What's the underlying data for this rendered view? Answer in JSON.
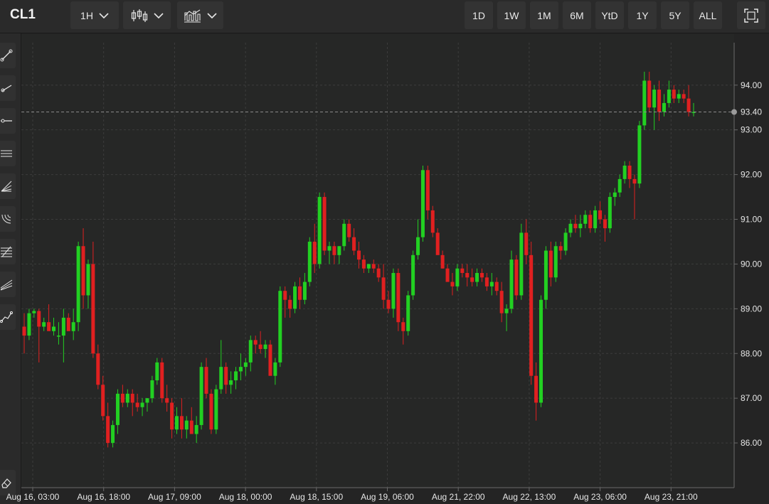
{
  "header": {
    "symbol": "CL1",
    "interval_label": "1H",
    "chart_type_icon": "candlestick-icon",
    "indicators_icon": "indicators-icon",
    "ranges": [
      "1D",
      "1W",
      "1M",
      "6M",
      "YtD",
      "1Y",
      "5Y",
      "ALL"
    ],
    "fullscreen_icon": "fullscreen-icon"
  },
  "sidebar": {
    "tools": [
      "trendline-icon",
      "ray-icon",
      "horizontal-line-icon",
      "parallel-channel-icon",
      "fan-icon",
      "arc-icon",
      "fibonacci-retracement-icon",
      "fibonacci-fan-icon",
      "polyline-icon"
    ],
    "bottom_tool": "eraser-icon"
  },
  "colors": {
    "up": "#22d022",
    "down": "#e02020",
    "background": "#262726",
    "grid": "#3c3c3c",
    "text": "#e6e6e6"
  },
  "chart_data": {
    "type": "candlestick",
    "title": "",
    "ylim": [
      85.0,
      94.95
    ],
    "y_ticks": [
      "86.00",
      "87.00",
      "88.00",
      "89.00",
      "90.00",
      "91.00",
      "92.00",
      "93.00",
      "94.00"
    ],
    "last_price": "93.40",
    "x_ticks": [
      "Aug 16, 03:00",
      "Aug 16, 18:00",
      "Aug 17, 09:00",
      "Aug 18, 00:00",
      "Aug 18, 15:00",
      "Aug 19, 06:00",
      "Aug 21, 22:00",
      "Aug 22, 13:00",
      "Aug 23, 06:00",
      "Aug 23, 21:00"
    ],
    "grid": true,
    "candles": [
      [
        88.6,
        88.9,
        88.0,
        88.4
      ],
      [
        88.4,
        89.0,
        88.3,
        88.9
      ],
      [
        88.9,
        89.0,
        88.8,
        88.95
      ],
      [
        88.95,
        89.0,
        87.8,
        88.6
      ],
      [
        88.6,
        88.8,
        88.5,
        88.7
      ],
      [
        88.7,
        89.1,
        88.6,
        88.5
      ],
      [
        88.5,
        88.8,
        88.4,
        88.6
      ],
      [
        88.4,
        88.7,
        88.2,
        88.4
      ],
      [
        88.4,
        89.0,
        87.8,
        88.8
      ],
      [
        88.8,
        88.9,
        88.6,
        88.5
      ],
      [
        88.5,
        89.0,
        88.3,
        88.7
      ],
      [
        88.7,
        90.5,
        88.5,
        90.4
      ],
      [
        90.4,
        90.8,
        89.0,
        89.3
      ],
      [
        89.3,
        90.1,
        89.0,
        90.0
      ],
      [
        90.0,
        90.5,
        87.9,
        88.0
      ],
      [
        88.0,
        88.2,
        87.2,
        87.3
      ],
      [
        87.3,
        87.5,
        86.5,
        86.6
      ],
      [
        86.6,
        86.9,
        85.9,
        86.0
      ],
      [
        86.0,
        86.5,
        85.9,
        86.4
      ],
      [
        86.4,
        87.2,
        86.2,
        87.1
      ],
      [
        87.1,
        87.3,
        86.8,
        86.9
      ],
      [
        86.9,
        87.2,
        86.8,
        87.1
      ],
      [
        87.1,
        87.2,
        86.6,
        86.9
      ],
      [
        86.9,
        87.1,
        86.7,
        86.8
      ],
      [
        86.8,
        87.0,
        86.6,
        86.9
      ],
      [
        86.9,
        87.0,
        86.7,
        87.0
      ],
      [
        87.0,
        87.5,
        86.9,
        87.4
      ],
      [
        87.4,
        87.9,
        87.3,
        87.8
      ],
      [
        87.8,
        87.9,
        86.9,
        87.0
      ],
      [
        87.0,
        87.3,
        86.7,
        86.9
      ],
      [
        86.9,
        87.0,
        86.1,
        86.3
      ],
      [
        86.3,
        86.8,
        86.2,
        86.6
      ],
      [
        86.6,
        87.0,
        86.1,
        86.3
      ],
      [
        86.3,
        86.6,
        86.1,
        86.5
      ],
      [
        86.5,
        86.8,
        86.3,
        86.2
      ],
      [
        86.2,
        86.6,
        86.0,
        86.4
      ],
      [
        86.4,
        87.8,
        86.3,
        87.7
      ],
      [
        87.7,
        87.9,
        87.0,
        87.1
      ],
      [
        87.1,
        87.2,
        86.2,
        86.3
      ],
      [
        86.3,
        87.3,
        86.2,
        87.2
      ],
      [
        87.2,
        88.3,
        87.1,
        87.7
      ],
      [
        87.7,
        87.8,
        87.1,
        87.3
      ],
      [
        87.3,
        87.6,
        87.1,
        87.4
      ],
      [
        87.4,
        87.7,
        87.2,
        87.6
      ],
      [
        87.6,
        88.0,
        87.4,
        87.7
      ],
      [
        87.7,
        87.9,
        87.5,
        87.8
      ],
      [
        87.8,
        88.4,
        87.6,
        88.3
      ],
      [
        88.3,
        88.4,
        88.0,
        88.2
      ],
      [
        88.2,
        88.5,
        88.0,
        88.1
      ],
      [
        88.1,
        88.3,
        87.9,
        88.2
      ],
      [
        88.2,
        88.3,
        87.8,
        87.5
      ],
      [
        87.5,
        87.9,
        87.3,
        87.8
      ],
      [
        87.8,
        89.5,
        87.7,
        89.4
      ],
      [
        89.4,
        89.5,
        88.8,
        89.2
      ],
      [
        89.2,
        89.3,
        88.8,
        89.0
      ],
      [
        89.0,
        89.6,
        88.9,
        89.5
      ],
      [
        89.5,
        89.7,
        89.0,
        89.2
      ],
      [
        89.2,
        89.8,
        89.1,
        89.6
      ],
      [
        89.6,
        90.6,
        89.5,
        90.5
      ],
      [
        90.5,
        90.9,
        89.8,
        90.0
      ],
      [
        90.0,
        91.6,
        89.9,
        91.5
      ],
      [
        91.5,
        91.6,
        90.2,
        90.3
      ],
      [
        90.3,
        90.5,
        90.0,
        90.4
      ],
      [
        90.4,
        90.5,
        90.0,
        90.2
      ],
      [
        90.2,
        90.4,
        90.0,
        90.4
      ],
      [
        90.4,
        91.0,
        90.3,
        90.9
      ],
      [
        90.9,
        91.0,
        90.5,
        90.6
      ],
      [
        90.6,
        90.8,
        90.2,
        90.3
      ],
      [
        90.3,
        90.5,
        89.9,
        90.1
      ],
      [
        90.1,
        90.2,
        89.8,
        89.9
      ],
      [
        89.9,
        90.0,
        89.8,
        90.0
      ],
      [
        90.0,
        90.1,
        89.8,
        89.9
      ],
      [
        89.9,
        90.0,
        89.6,
        89.7
      ],
      [
        89.7,
        90.0,
        89.0,
        89.2
      ],
      [
        89.2,
        89.4,
        88.9,
        89.0
      ],
      [
        89.0,
        89.9,
        88.8,
        89.8
      ],
      [
        89.8,
        89.9,
        88.5,
        88.7
      ],
      [
        88.7,
        88.8,
        88.2,
        88.5
      ],
      [
        88.5,
        89.4,
        88.4,
        89.3
      ],
      [
        89.3,
        90.3,
        89.2,
        90.2
      ],
      [
        90.2,
        91.0,
        90.1,
        90.6
      ],
      [
        90.6,
        92.2,
        90.5,
        92.1
      ],
      [
        92.1,
        92.2,
        91.0,
        91.2
      ],
      [
        91.2,
        91.3,
        90.6,
        90.7
      ],
      [
        90.7,
        90.8,
        90.3,
        90.2
      ],
      [
        90.2,
        90.3,
        89.9,
        89.9
      ],
      [
        89.9,
        90.0,
        89.7,
        89.6
      ],
      [
        89.6,
        89.8,
        89.3,
        89.5
      ],
      [
        89.5,
        90.0,
        89.4,
        89.9
      ],
      [
        89.9,
        90.0,
        89.7,
        89.8
      ],
      [
        89.8,
        90.0,
        89.5,
        89.7
      ],
      [
        89.7,
        89.9,
        89.5,
        89.6
      ],
      [
        89.6,
        89.9,
        89.5,
        89.8
      ],
      [
        89.8,
        89.9,
        89.6,
        89.7
      ],
      [
        89.7,
        89.8,
        89.4,
        89.5
      ],
      [
        89.5,
        89.8,
        89.3,
        89.6
      ],
      [
        89.6,
        89.7,
        89.3,
        89.4
      ],
      [
        89.4,
        89.6,
        88.7,
        88.9
      ],
      [
        88.9,
        89.1,
        88.5,
        89.0
      ],
      [
        89.0,
        90.3,
        88.9,
        90.1
      ],
      [
        90.1,
        90.2,
        89.2,
        89.3
      ],
      [
        89.3,
        90.9,
        89.2,
        90.7
      ],
      [
        90.7,
        91.0,
        90.0,
        90.2
      ],
      [
        90.2,
        90.5,
        87.3,
        87.5
      ],
      [
        87.5,
        87.8,
        86.5,
        86.9
      ],
      [
        86.9,
        89.3,
        86.8,
        89.2
      ],
      [
        89.2,
        90.4,
        89.0,
        90.3
      ],
      [
        90.3,
        90.5,
        89.5,
        89.7
      ],
      [
        89.7,
        90.5,
        89.6,
        90.4
      ],
      [
        90.4,
        90.5,
        90.1,
        90.3
      ],
      [
        90.3,
        90.8,
        90.2,
        90.7
      ],
      [
        90.7,
        91.0,
        90.6,
        90.9
      ],
      [
        90.9,
        91.1,
        90.7,
        90.8
      ],
      [
        90.8,
        91.1,
        90.6,
        90.9
      ],
      [
        90.9,
        91.2,
        90.8,
        91.1
      ],
      [
        91.1,
        91.2,
        90.7,
        90.8
      ],
      [
        90.8,
        91.3,
        90.7,
        91.2
      ],
      [
        91.2,
        91.4,
        90.9,
        91.0
      ],
      [
        91.0,
        91.1,
        90.5,
        90.8
      ],
      [
        90.8,
        91.6,
        90.7,
        91.5
      ],
      [
        91.5,
        91.7,
        91.3,
        91.6
      ],
      [
        91.6,
        92.0,
        91.5,
        91.9
      ],
      [
        91.9,
        92.3,
        91.8,
        92.2
      ],
      [
        92.2,
        92.3,
        91.7,
        91.9
      ],
      [
        91.9,
        92.0,
        91.0,
        91.8
      ],
      [
        91.8,
        93.2,
        91.7,
        93.1
      ],
      [
        93.1,
        94.3,
        93.0,
        94.1
      ],
      [
        94.1,
        94.3,
        93.4,
        93.5
      ],
      [
        93.5,
        94.0,
        93.0,
        93.9
      ],
      [
        93.9,
        94.1,
        93.2,
        93.4
      ],
      [
        93.4,
        93.8,
        93.3,
        93.6
      ],
      [
        93.6,
        94.1,
        93.5,
        93.9
      ],
      [
        93.9,
        94.0,
        93.6,
        93.7
      ],
      [
        93.7,
        93.9,
        93.6,
        93.8
      ],
      [
        93.8,
        93.9,
        93.6,
        93.7
      ],
      [
        93.7,
        94.0,
        93.3,
        93.4
      ],
      [
        93.4,
        93.6,
        93.3,
        93.4
      ]
    ]
  }
}
